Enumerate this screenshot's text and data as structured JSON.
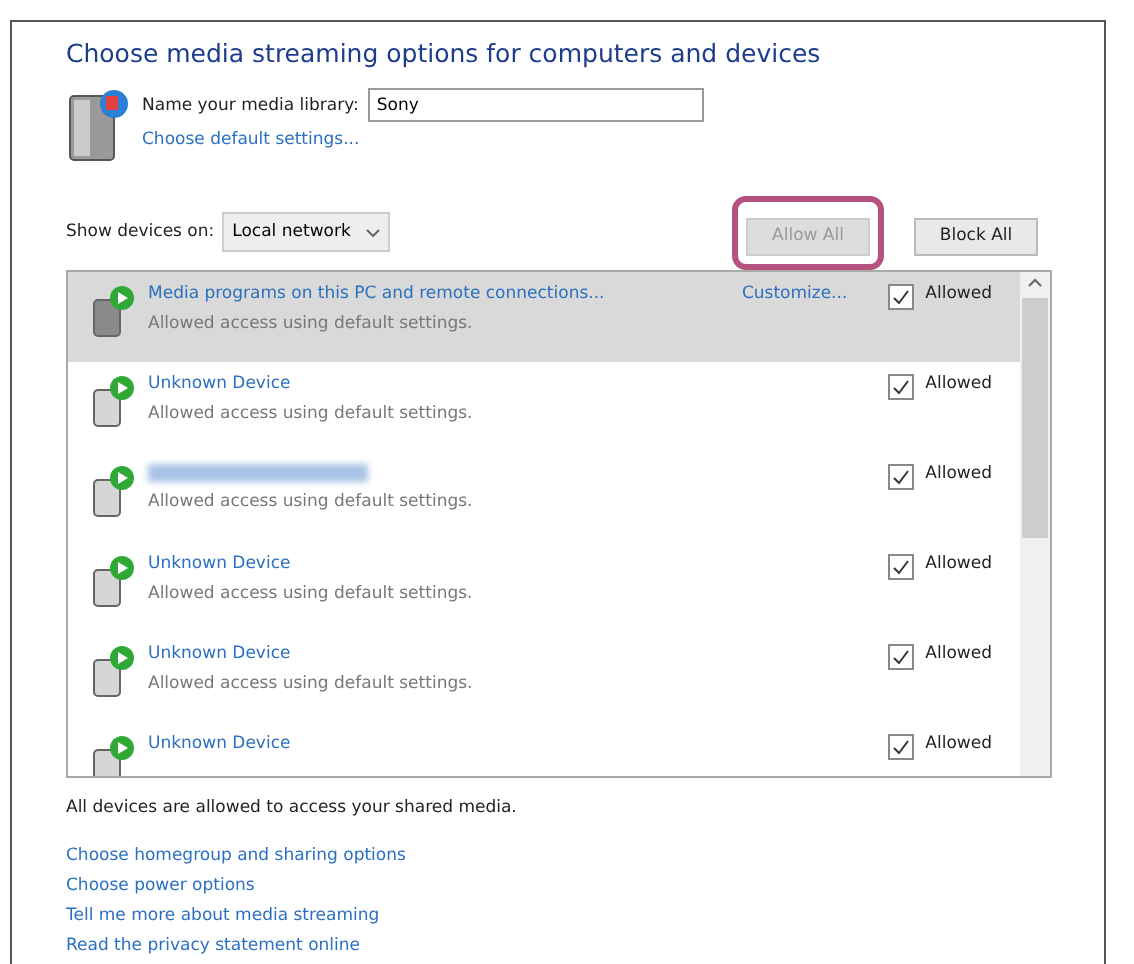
{
  "title": "Choose media streaming options for computers and devices",
  "library": {
    "label": "Name your media library:",
    "value": "Sony",
    "link": "Choose default settings..."
  },
  "show_devices": {
    "label": "Show devices on:",
    "value": "Local network"
  },
  "buttons": [
    {
      "label": "Allow All",
      "disabled": true,
      "highlighted": true
    },
    {
      "label": "Block All",
      "disabled": false,
      "highlighted": false
    }
  ],
  "devices": [
    {
      "kind": "pc",
      "name": "Media programs on this PC and remote connections...",
      "blurred": false,
      "description": "Allowed access using default settings.",
      "customize": "Customize...",
      "allowed": true,
      "allowed_label": "Allowed",
      "selected": true
    },
    {
      "kind": "device",
      "name": "Unknown Device",
      "blurred": false,
      "description": "Allowed access using default settings.",
      "allowed": true,
      "allowed_label": "Allowed",
      "selected": false
    },
    {
      "kind": "device",
      "blurred": true,
      "description": "Allowed access using default settings.",
      "allowed": true,
      "allowed_label": "Allowed",
      "selected": false
    },
    {
      "kind": "device",
      "name": "Unknown Device",
      "blurred": false,
      "description": "Allowed access using default settings.",
      "allowed": true,
      "allowed_label": "Allowed",
      "selected": false
    },
    {
      "kind": "device",
      "name": "Unknown Device",
      "blurred": false,
      "description": "Allowed access using default settings.",
      "allowed": true,
      "allowed_label": "Allowed",
      "selected": false
    },
    {
      "kind": "device",
      "name": "Unknown Device",
      "blurred": false,
      "allowed": true,
      "allowed_label": "Allowed",
      "selected": false
    }
  ],
  "status": "All devices are allowed to access your shared media.",
  "links": [
    "Choose homegroup and sharing options",
    "Choose power options",
    "Tell me more about media streaming",
    "Read the privacy statement online"
  ]
}
